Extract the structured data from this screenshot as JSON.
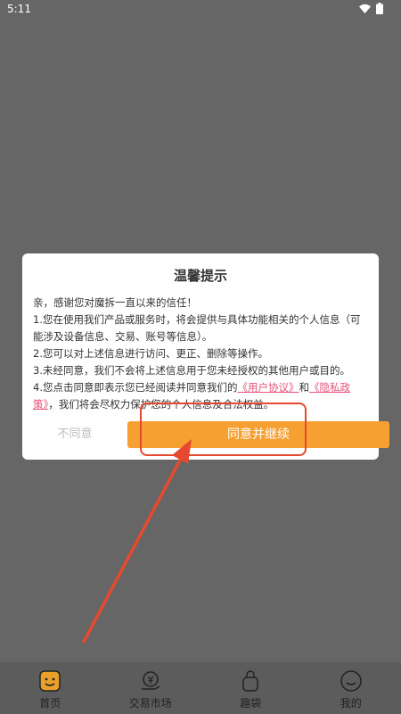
{
  "status_bar": {
    "time": "5:11"
  },
  "dialog": {
    "title": "温馨提示",
    "line1": "亲，感谢您对魔拆一直以来的信任！",
    "line2": "1.您在使用我们产品或服务时，将会提供与具体功能相关的个人信息（可能涉及设备信息、交易、账号等信息）。",
    "line3": "2.您可以对上述信息进行访问、更正、删除等操作。",
    "line4": "3.未经同意，我们不会将上述信息用于您未经授权的其他用户或目的。",
    "line5_prefix": "4.您点击同意即表示您已经阅读并同意我们的",
    "user_agreement": "《用户协议》",
    "and": "和",
    "privacy_policy": "《隐私政策》",
    "line5_suffix": "，我们将会尽权力保护您的个人信息及合法权益。",
    "disagree_label": "不同意",
    "agree_label": "同意并继续"
  },
  "bottom_nav": {
    "items": [
      {
        "label": "首页",
        "icon": "home-face-icon"
      },
      {
        "label": "交易市场",
        "icon": "market-icon"
      },
      {
        "label": "趣袋",
        "icon": "bag-icon"
      },
      {
        "label": "我的",
        "icon": "profile-icon"
      }
    ]
  },
  "colors": {
    "overlay": "#666666",
    "accent": "#f5a030",
    "link": "#e8527a",
    "annotation": "#e64a2e"
  }
}
